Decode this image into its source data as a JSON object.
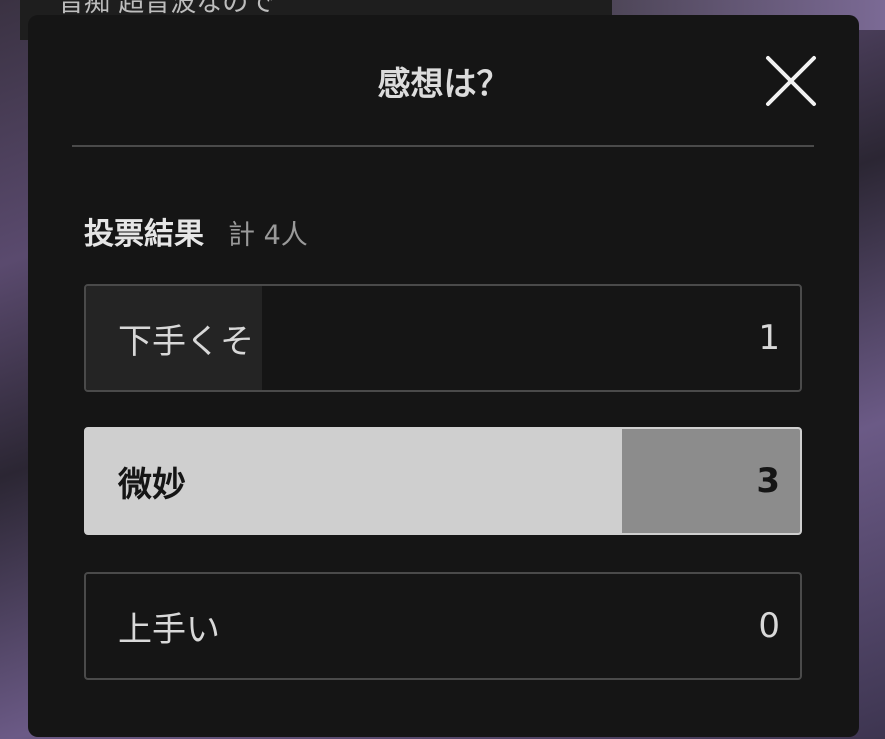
{
  "background": {
    "strip_text": "音痴 超音波なので"
  },
  "modal": {
    "title": "感想は？",
    "close_icon": "close-icon"
  },
  "results": {
    "heading": "投票結果",
    "total": "計 4人",
    "options": [
      {
        "label": "下手くそ",
        "count": "1",
        "share": 0.25,
        "selected": false
      },
      {
        "label": "微妙",
        "count": "3",
        "share": 0.75,
        "selected": true
      },
      {
        "label": "上手い",
        "count": "0",
        "share": 0.0,
        "selected": false
      }
    ]
  },
  "colors": {
    "modal_bg": "#151515",
    "selected_bg": "#cfcfcf",
    "selected_bar": "#8c8c8c",
    "border": "#4a4a4a"
  }
}
